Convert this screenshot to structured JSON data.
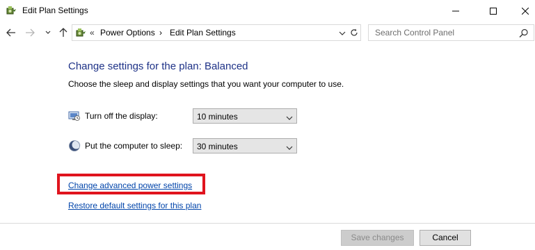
{
  "window": {
    "title": "Edit Plan Settings"
  },
  "navigation": {
    "breadcrumb_prefix": "«",
    "breadcrumb_items": [
      "Power Options",
      "Edit Plan Settings"
    ],
    "breadcrumb_separator": "›",
    "search_placeholder": "Search Control Panel"
  },
  "main": {
    "heading": "Change settings for the plan: Balanced",
    "description": "Choose the sleep and display settings that you want your computer to use.",
    "settings": [
      {
        "label": "Turn off the display:",
        "value": "10 minutes",
        "icon": "display-icon"
      },
      {
        "label": "Put the computer to sleep:",
        "value": "30 minutes",
        "icon": "sleep-moon-icon"
      }
    ],
    "links": {
      "advanced": "Change advanced power settings",
      "restore": "Restore default settings for this plan"
    }
  },
  "footer": {
    "save_label": "Save changes",
    "cancel_label": "Cancel"
  },
  "colors": {
    "heading": "#1e3287",
    "link": "#0044aa",
    "highlight": "#e0141e"
  }
}
